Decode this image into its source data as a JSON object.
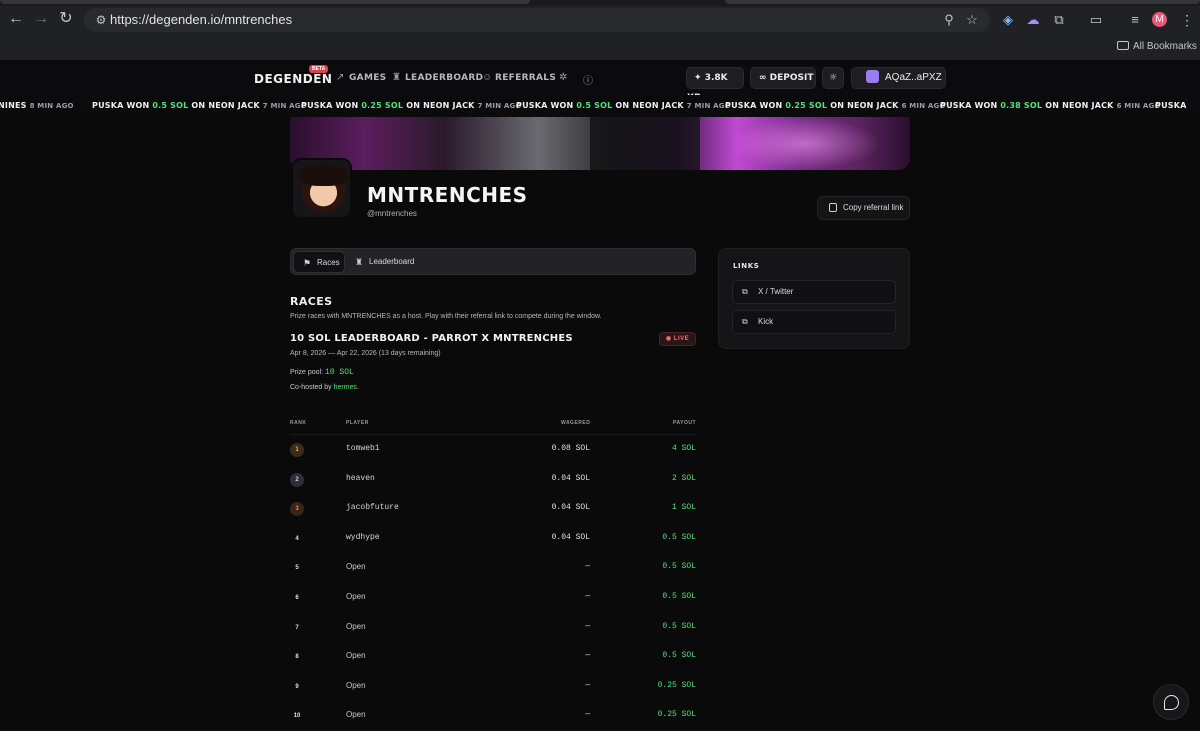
{
  "browser": {
    "url": "https://degenden.io/mntrenches",
    "bookmarks_label": "All Bookmarks",
    "profile_initial": "M"
  },
  "header": {
    "logo": "DEGENDEN",
    "beta": "BETA",
    "nav": [
      {
        "label": "GAMES",
        "icon": "trending-up-icon"
      },
      {
        "label": "LEADERBOARD",
        "icon": "trophy-icon"
      },
      {
        "label": "REFERRALS",
        "icon": "users-icon"
      }
    ],
    "xp": "3.8K XP",
    "deposit": "DEPOSIT",
    "wallet": "AQaZ..aPXZ"
  },
  "ticker": [
    {
      "lead": "",
      "player": "",
      "amount": "",
      "game": "NINES",
      "ago": "8 MIN AGO"
    },
    {
      "player": "PUSKA",
      "amount": "0.5 SOL",
      "game": "NEON JACK",
      "ago": "7 MIN AGO"
    },
    {
      "player": "PUSKA",
      "amount": "0.25 SOL",
      "game": "NEON JACK",
      "ago": "7 MIN AGO"
    },
    {
      "player": "PUSKA",
      "amount": "0.5 SOL",
      "game": "NEON JACK",
      "ago": "7 MIN AGO"
    },
    {
      "player": "PUSKA",
      "amount": "0.25 SOL",
      "game": "NEON JACK",
      "ago": "6 MIN AGO"
    },
    {
      "player": "PUSKA",
      "amount": "0.38 SOL",
      "game": "NEON JACK",
      "ago": "6 MIN AGO"
    },
    {
      "player": "PUSKA",
      "amount": "",
      "game": "",
      "ago": ""
    }
  ],
  "profile": {
    "name": "MNTRENCHES",
    "handle": "@mntrenches",
    "copy_referral": "Copy referral link"
  },
  "tabs": [
    {
      "label": "Races",
      "active": true
    },
    {
      "label": "Leaderboard",
      "active": false
    }
  ],
  "links": {
    "title": "LINKS",
    "items": [
      {
        "label": "X / Twitter"
      },
      {
        "label": "Kick"
      }
    ]
  },
  "races": {
    "title": "RACES",
    "description": "Prize races with MNTRENCHES as a host. Play with their referral link to compete during the window.",
    "race_name": "10 SOL LEADERBOARD - PARROT X MNTRENCHES",
    "live": "LIVE",
    "dates": "Apr 8, 2026 — Apr 22, 2026 (13 days remaining)",
    "prize_label": "Prize pool:",
    "prize_value": "10 SOL",
    "cohost_label": "Co-hosted by",
    "cohost_name": "hermes",
    "cohost_suffix": "."
  },
  "table": {
    "headers": {
      "rank": "RANK",
      "player": "PLAYER",
      "wagered": "WAGERED",
      "payout": "PAYOUT"
    },
    "rows": [
      {
        "rank": "1",
        "player": "tomweb1",
        "wagered": "0.08 SOL",
        "payout": "4 SOL"
      },
      {
        "rank": "2",
        "player": "heaven",
        "wagered": "0.04 SOL",
        "payout": "2 SOL"
      },
      {
        "rank": "3",
        "player": "jacobfuture",
        "wagered": "0.04 SOL",
        "payout": "1 SOL"
      },
      {
        "rank": "4",
        "player": "wydhype",
        "wagered": "0.04 SOL",
        "payout": "0.5 SOL"
      },
      {
        "rank": "5",
        "player": "Open",
        "wagered": "—",
        "payout": "0.5 SOL"
      },
      {
        "rank": "6",
        "player": "Open",
        "wagered": "—",
        "payout": "0.5 SOL"
      },
      {
        "rank": "7",
        "player": "Open",
        "wagered": "—",
        "payout": "0.5 SOL"
      },
      {
        "rank": "8",
        "player": "Open",
        "wagered": "—",
        "payout": "0.5 SOL"
      },
      {
        "rank": "9",
        "player": "Open",
        "wagered": "—",
        "payout": "0.25 SOL"
      },
      {
        "rank": "10",
        "player": "Open",
        "wagered": "—",
        "payout": "0.25 SOL"
      }
    ]
  },
  "colors": {
    "accent_green": "#55e07a",
    "live_red": "#ff6b6b",
    "beta_red": "#e0424b"
  }
}
